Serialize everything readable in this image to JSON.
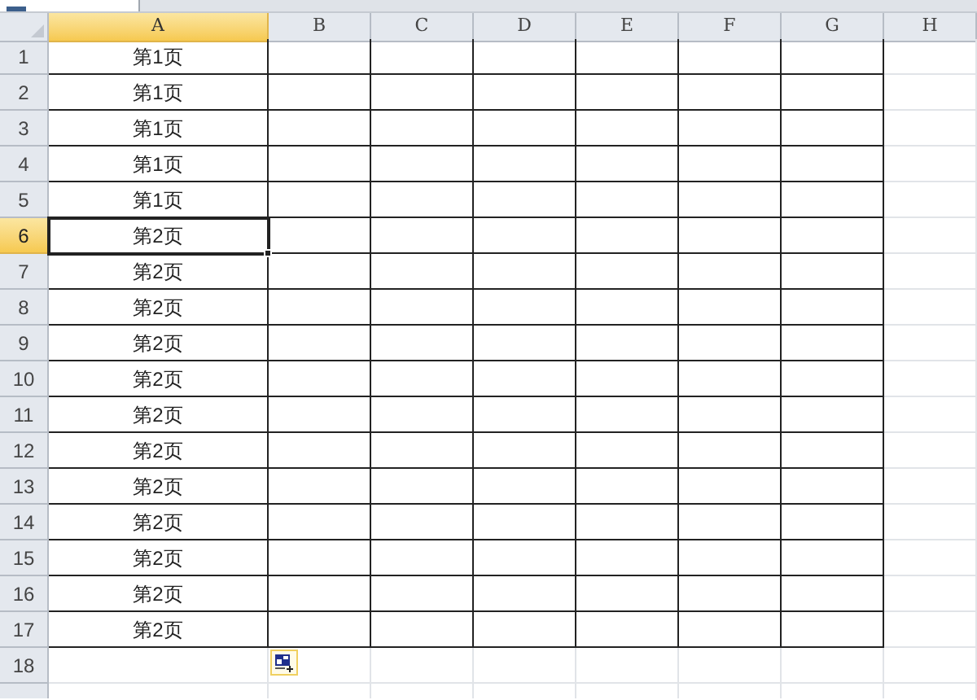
{
  "columns": [
    {
      "label": "A",
      "selected": true
    },
    {
      "label": "B",
      "selected": false
    },
    {
      "label": "C",
      "selected": false
    },
    {
      "label": "D",
      "selected": false
    },
    {
      "label": "E",
      "selected": false
    },
    {
      "label": "F",
      "selected": false
    },
    {
      "label": "G",
      "selected": false
    },
    {
      "label": "H",
      "selected": false
    }
  ],
  "rows": [
    {
      "header": "1",
      "selected": false,
      "bordered": true,
      "cell_a": "第1页"
    },
    {
      "header": "2",
      "selected": false,
      "bordered": true,
      "cell_a": "第1页"
    },
    {
      "header": "3",
      "selected": false,
      "bordered": true,
      "cell_a": "第1页"
    },
    {
      "header": "4",
      "selected": false,
      "bordered": true,
      "cell_a": "第1页"
    },
    {
      "header": "5",
      "selected": false,
      "bordered": true,
      "cell_a": "第1页"
    },
    {
      "header": "6",
      "selected": true,
      "bordered": true,
      "cell_a": "第2页"
    },
    {
      "header": "7",
      "selected": false,
      "bordered": true,
      "cell_a": "第2页"
    },
    {
      "header": "8",
      "selected": false,
      "bordered": true,
      "cell_a": "第2页"
    },
    {
      "header": "9",
      "selected": false,
      "bordered": true,
      "cell_a": "第2页"
    },
    {
      "header": "10",
      "selected": false,
      "bordered": true,
      "cell_a": "第2页"
    },
    {
      "header": "11",
      "selected": false,
      "bordered": true,
      "cell_a": "第2页"
    },
    {
      "header": "12",
      "selected": false,
      "bordered": true,
      "cell_a": "第2页"
    },
    {
      "header": "13",
      "selected": false,
      "bordered": true,
      "cell_a": "第2页"
    },
    {
      "header": "14",
      "selected": false,
      "bordered": true,
      "cell_a": "第2页"
    },
    {
      "header": "15",
      "selected": false,
      "bordered": true,
      "cell_a": "第2页"
    },
    {
      "header": "16",
      "selected": false,
      "bordered": true,
      "cell_a": "第2页"
    },
    {
      "header": "17",
      "selected": false,
      "bordered": true,
      "cell_a": "第2页"
    },
    {
      "header": "18",
      "selected": false,
      "bordered": false,
      "cell_a": ""
    }
  ]
}
